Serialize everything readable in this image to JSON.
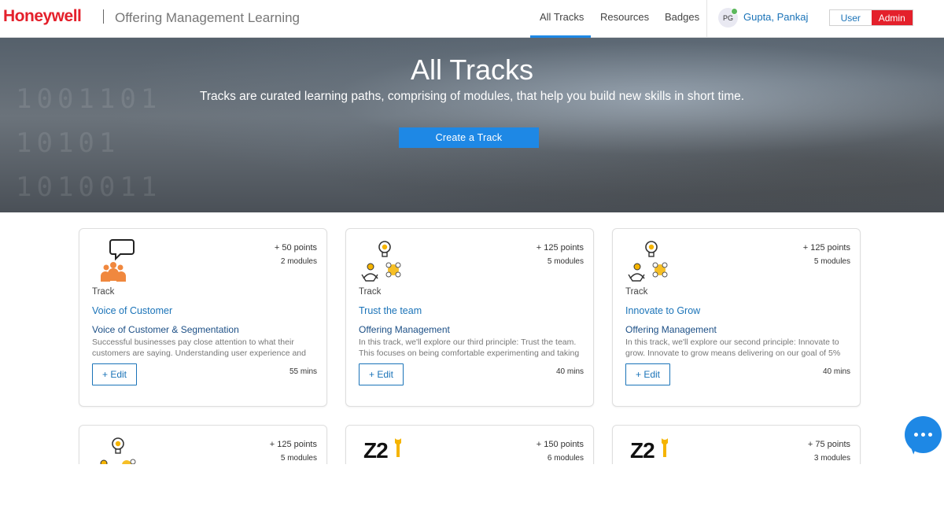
{
  "header": {
    "logo": "Honeywell",
    "app_title": "Offering Management Learning",
    "nav": [
      "All Tracks",
      "Resources",
      "Badges"
    ],
    "user": {
      "initials": "PG",
      "name": "Gupta, Pankaj"
    },
    "roles": {
      "user": "User",
      "admin": "Admin"
    }
  },
  "hero": {
    "title": "All Tracks",
    "subtitle": "Tracks are curated learning paths, comprising of modules, that help you build new skills in short time.",
    "button": "Create a Track"
  },
  "cards": [
    {
      "icon": "people-speech-icon",
      "points": "+ 50 points",
      "modules": "2 modules",
      "type": "Track",
      "title": "Voice of Customer",
      "subtitle": "Voice of Customer & Segmentation",
      "description": "Successful businesses pay close attention to what their customers are saying. Understanding user experience and",
      "edit": "+ Edit",
      "duration": "55 mins"
    },
    {
      "icon": "idea-team-icon",
      "points": "+ 125 points",
      "modules": "5 modules",
      "type": "Track",
      "title": "Trust the team",
      "subtitle": "Offering Management",
      "description": "In this track, we'll explore our third principle: Trust the team. This focuses on being comfortable experimenting and taking",
      "edit": "+ Edit",
      "duration": "40 mins"
    },
    {
      "icon": "idea-team-icon",
      "points": "+ 125 points",
      "modules": "5 modules",
      "type": "Track",
      "title": "Innovate to Grow",
      "subtitle": "Offering Management",
      "description": "In this track, we'll explore our second principle: Innovate to grow. Innovate to grow means delivering on our goal of 5%",
      "edit": "+ Edit",
      "duration": "40 mins"
    },
    {
      "icon": "idea-team-icon",
      "points": "+ 125 points",
      "modules": "5 modules"
    },
    {
      "icon": "z2-logo",
      "logo_text": "Z2",
      "points": "+ 150 points",
      "modules": "6 modules"
    },
    {
      "icon": "z2-logo",
      "logo_text": "Z2",
      "points": "+ 75 points",
      "modules": "3 modules"
    }
  ],
  "colors": {
    "brand_red": "#e4202b",
    "accent_blue": "#1e88e5",
    "link_blue": "#1a73b8"
  }
}
